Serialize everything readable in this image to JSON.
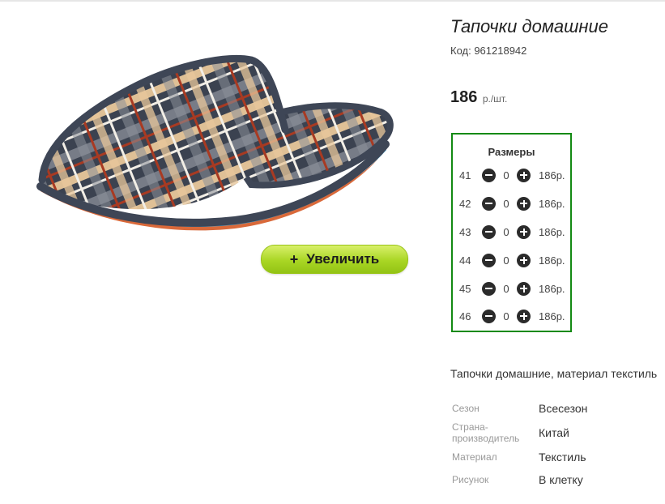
{
  "product": {
    "title": "Тапочки домашние",
    "code": "Код: 961218942",
    "price_value": "186",
    "price_unit": "р./шт.",
    "description": "Тапочки домашние, материал текстиль"
  },
  "image": {
    "alt": "Тапочки домашние в клетку",
    "zoom_label": "Увеличить",
    "zoom_icon": "+"
  },
  "sizes": {
    "title": "Размеры",
    "items": [
      {
        "size": "41",
        "qty": "0",
        "price": "186р."
      },
      {
        "size": "42",
        "qty": "0",
        "price": "186р."
      },
      {
        "size": "43",
        "qty": "0",
        "price": "186р."
      },
      {
        "size": "44",
        "qty": "0",
        "price": "186р."
      },
      {
        "size": "45",
        "qty": "0",
        "price": "186р."
      },
      {
        "size": "46",
        "qty": "0",
        "price": "186р."
      }
    ]
  },
  "attributes": [
    {
      "label": "Сезон",
      "value": "Всесезон"
    },
    {
      "label": "Страна-производитель",
      "value": "Китай"
    },
    {
      "label": "Материал",
      "value": "Текстиль"
    },
    {
      "label": "Рисунок",
      "value": "В клетку"
    }
  ],
  "colors": {
    "sizes_border": "#138a13",
    "zoom_button": "#a9d624"
  }
}
